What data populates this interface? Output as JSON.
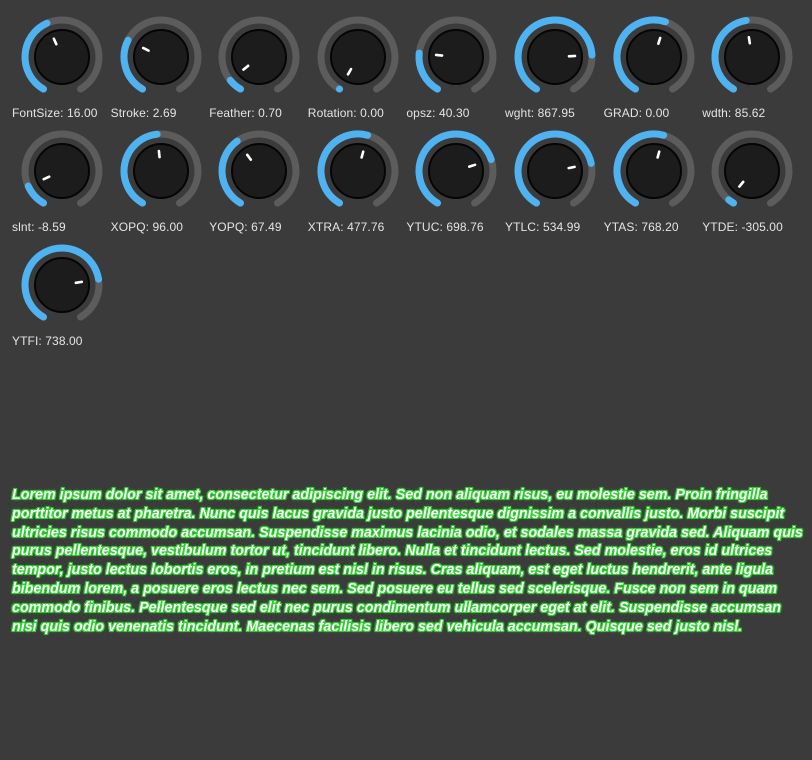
{
  "colors": {
    "background": "#3b3b3b",
    "track": "#5c5c5c",
    "arc": "#4fb3f2",
    "knob_body": "#1c1c1c",
    "knob_ring": "#050505",
    "pointer": "#ffffff",
    "label": "#e4e4e4",
    "text_fill": "#ffffff",
    "text_stroke": "#2ecf2e"
  },
  "knobs": [
    {
      "label": "FontSize: 16.00",
      "level": 0.42
    },
    {
      "label": "Stroke: 2.69",
      "level": 0.29
    },
    {
      "label": "Feather: 0.70",
      "level": 0.07
    },
    {
      "label": "Rotation: 0.00",
      "level": 0.0
    },
    {
      "label": "opsz: 40.30",
      "level": 0.22
    },
    {
      "label": "wght: 867.95",
      "level": 0.79
    },
    {
      "label": "GRAD: 0.00",
      "level": 0.56
    },
    {
      "label": "wdth: 85.62",
      "level": 0.47
    },
    {
      "label": "slnt: -8.59",
      "level": 0.12
    },
    {
      "label": "XOPQ: 96.00",
      "level": 0.48
    },
    {
      "label": "YOPQ: 67.49",
      "level": 0.38
    },
    {
      "label": "XTRA: 477.76",
      "level": 0.55
    },
    {
      "label": "YTUC: 698.76",
      "level": 0.74
    },
    {
      "label": "YTLC: 534.99",
      "level": 0.76
    },
    {
      "label": "YTAS: 768.20",
      "level": 0.55
    },
    {
      "label": "YTDE: -305.00",
      "level": 0.03
    },
    {
      "label": "YTFI: 738.00",
      "level": 0.77
    }
  ],
  "sample_text": "Lorem ipsum dolor sit amet, consectetur adipiscing elit. Sed non aliquam risus, eu molestie sem. Proin fringilla porttitor metus at pharetra. Nunc quis lacus gravida justo pellentesque dignissim a convallis justo. Morbi suscipit ultricies risus commodo accumsan. Suspendisse maximus lacinia odio, et sodales massa gravida sed. Aliquam quis purus pellentesque, vestibulum tortor ut, tincidunt libero. Nulla et tincidunt lectus. Sed molestie, eros id ultrices tempor, justo lectus lobortis eros, in pretium est nisl in risus. Cras aliquam, est eget luctus hendrerit, ante ligula bibendum lorem, a posuere eros lectus nec sem. Sed posuere eu tellus sed scelerisque. Fusce non sem in quam commodo finibus. Pellentesque sed elit nec purus condimentum ullamcorper eget at elit. Suspendisse accumsan nisi quis odio venenatis tincidunt. Maecenas facilisis libero sed vehicula accumsan. Quisque sed justo nisl."
}
